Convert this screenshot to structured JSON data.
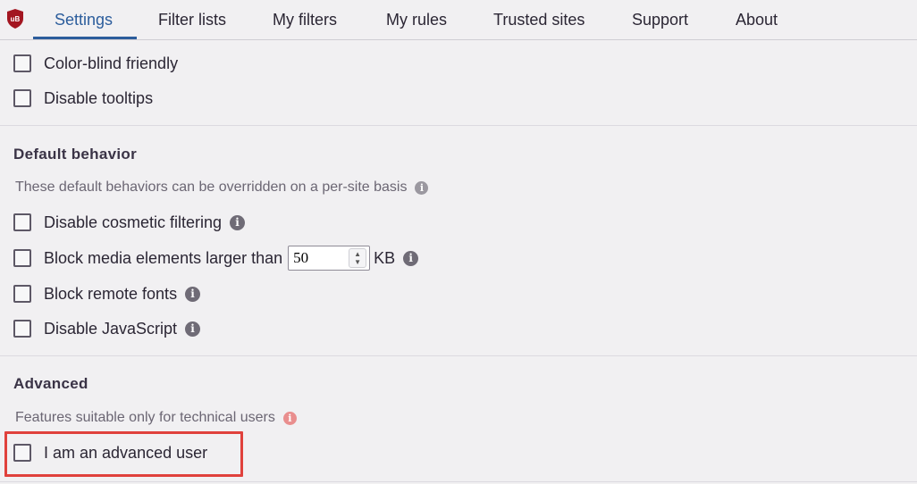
{
  "tabs": [
    {
      "label": "Settings"
    },
    {
      "label": "Filter lists"
    },
    {
      "label": "My filters"
    },
    {
      "label": "My rules"
    },
    {
      "label": "Trusted sites"
    },
    {
      "label": "Support"
    },
    {
      "label": "About"
    }
  ],
  "appearance": {
    "options": [
      {
        "label": "Color-blind friendly",
        "checked": false
      },
      {
        "label": "Disable tooltips",
        "checked": false
      }
    ]
  },
  "default_behavior": {
    "title": "Default behavior",
    "description": "These default behaviors can be overridden on a per-site basis",
    "options": [
      {
        "label": "Disable cosmetic filtering",
        "checked": false
      },
      {
        "label": "Block media elements larger than",
        "checked": false,
        "value": "50",
        "unit": "KB"
      },
      {
        "label": "Block remote fonts",
        "checked": false
      },
      {
        "label": "Disable JavaScript",
        "checked": false
      }
    ]
  },
  "advanced": {
    "title": "Advanced",
    "description": "Features suitable only for technical users",
    "options": [
      {
        "label": "I am an advanced user",
        "checked": false
      }
    ]
  },
  "colors": {
    "accent": "#2c5d9c",
    "highlight": "#e0413c",
    "logo": "#a31621"
  },
  "icons": {
    "info": "info-icon",
    "logo": "ublock-logo-icon"
  }
}
